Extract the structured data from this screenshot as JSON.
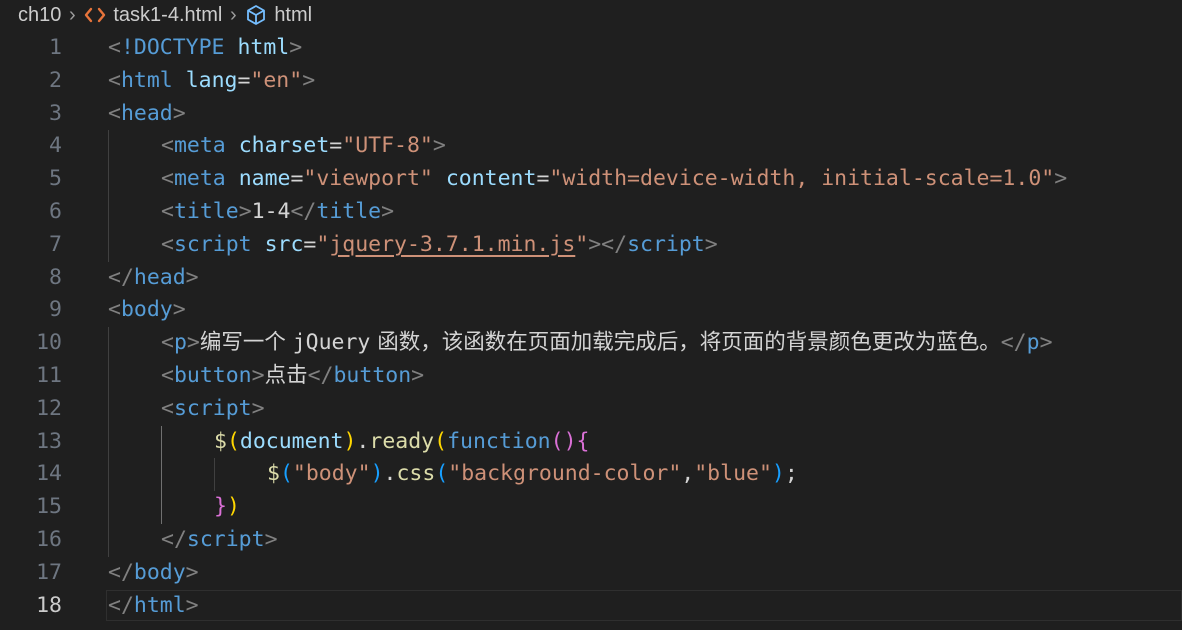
{
  "breadcrumb": {
    "folder": "ch10",
    "file": "task1-4.html",
    "symbol": "html"
  },
  "editor": {
    "current_line": "18",
    "lines": [
      {
        "n": "1",
        "indent": 0,
        "tokens": [
          [
            "punc",
            "<"
          ],
          [
            "tag",
            "!DOCTYPE"
          ],
          [
            "text",
            " "
          ],
          [
            "attr",
            "html"
          ],
          [
            "punc",
            ">"
          ]
        ]
      },
      {
        "n": "2",
        "indent": 0,
        "tokens": [
          [
            "punc",
            "<"
          ],
          [
            "tag",
            "html"
          ],
          [
            "text",
            " "
          ],
          [
            "attr",
            "lang"
          ],
          [
            "text",
            "="
          ],
          [
            "str",
            "\"en\""
          ],
          [
            "punc",
            ">"
          ]
        ]
      },
      {
        "n": "3",
        "indent": 0,
        "tokens": [
          [
            "punc",
            "<"
          ],
          [
            "tag",
            "head"
          ],
          [
            "punc",
            ">"
          ]
        ]
      },
      {
        "n": "4",
        "indent": 1,
        "tokens": [
          [
            "punc",
            "<"
          ],
          [
            "tag",
            "meta"
          ],
          [
            "text",
            " "
          ],
          [
            "attr",
            "charset"
          ],
          [
            "text",
            "="
          ],
          [
            "str",
            "\"UTF-8\""
          ],
          [
            "punc",
            ">"
          ]
        ]
      },
      {
        "n": "5",
        "indent": 1,
        "tokens": [
          [
            "punc",
            "<"
          ],
          [
            "tag",
            "meta"
          ],
          [
            "text",
            " "
          ],
          [
            "attr",
            "name"
          ],
          [
            "text",
            "="
          ],
          [
            "str",
            "\"viewport\""
          ],
          [
            "text",
            " "
          ],
          [
            "attr",
            "content"
          ],
          [
            "text",
            "="
          ],
          [
            "str",
            "\"width=device-width, initial-scale=1.0\""
          ],
          [
            "punc",
            ">"
          ]
        ]
      },
      {
        "n": "6",
        "indent": 1,
        "tokens": [
          [
            "punc",
            "<"
          ],
          [
            "tag",
            "title"
          ],
          [
            "punc",
            ">"
          ],
          [
            "text",
            "1-4"
          ],
          [
            "punc",
            "</"
          ],
          [
            "tag",
            "title"
          ],
          [
            "punc",
            ">"
          ]
        ]
      },
      {
        "n": "7",
        "indent": 1,
        "tokens": [
          [
            "punc",
            "<"
          ],
          [
            "tag",
            "script"
          ],
          [
            "text",
            " "
          ],
          [
            "attr",
            "src"
          ],
          [
            "text",
            "="
          ],
          [
            "str",
            "\""
          ],
          [
            "link",
            "jquery-3.7.1.min.js"
          ],
          [
            "str",
            "\""
          ],
          [
            "punc",
            "></"
          ],
          [
            "tag",
            "script"
          ],
          [
            "punc",
            ">"
          ]
        ]
      },
      {
        "n": "8",
        "indent": 0,
        "tokens": [
          [
            "punc",
            "</"
          ],
          [
            "tag",
            "head"
          ],
          [
            "punc",
            ">"
          ]
        ]
      },
      {
        "n": "9",
        "indent": 0,
        "tokens": [
          [
            "punc",
            "<"
          ],
          [
            "tag",
            "body"
          ],
          [
            "punc",
            ">"
          ]
        ]
      },
      {
        "n": "10",
        "indent": 1,
        "tokens": [
          [
            "punc",
            "<"
          ],
          [
            "tag",
            "p"
          ],
          [
            "punc",
            ">"
          ],
          [
            "cjk",
            "编写一个 "
          ],
          [
            "text",
            "jQuery"
          ],
          [
            "cjk",
            " 函数，该函数在页面加载完成后，将页面的背景颜色更改为蓝色。"
          ],
          [
            "punc",
            "</"
          ],
          [
            "tag",
            "p"
          ],
          [
            "punc",
            ">"
          ]
        ]
      },
      {
        "n": "11",
        "indent": 1,
        "tokens": [
          [
            "punc",
            "<"
          ],
          [
            "tag",
            "button"
          ],
          [
            "punc",
            ">"
          ],
          [
            "cjk",
            "点击"
          ],
          [
            "punc",
            "</"
          ],
          [
            "tag",
            "button"
          ],
          [
            "punc",
            ">"
          ]
        ]
      },
      {
        "n": "12",
        "indent": 1,
        "tokens": [
          [
            "punc",
            "<"
          ],
          [
            "tag",
            "script"
          ],
          [
            "punc",
            ">"
          ]
        ]
      },
      {
        "n": "13",
        "indent": 2,
        "tokens": [
          [
            "fn",
            "$"
          ],
          [
            "br1",
            "("
          ],
          [
            "var",
            "document"
          ],
          [
            "br1",
            ")"
          ],
          [
            "text",
            "."
          ],
          [
            "fn",
            "ready"
          ],
          [
            "br1",
            "("
          ],
          [
            "kw",
            "function"
          ],
          [
            "br2",
            "()"
          ],
          [
            "br2",
            "{"
          ]
        ]
      },
      {
        "n": "14",
        "indent": 3,
        "tokens": [
          [
            "fn",
            "$"
          ],
          [
            "br3",
            "("
          ],
          [
            "str",
            "\"body\""
          ],
          [
            "br3",
            ")"
          ],
          [
            "text",
            "."
          ],
          [
            "fn",
            "css"
          ],
          [
            "br3",
            "("
          ],
          [
            "str",
            "\"background-color\""
          ],
          [
            "text",
            ","
          ],
          [
            "str",
            "\"blue\""
          ],
          [
            "br3",
            ")"
          ],
          [
            "text",
            ";"
          ]
        ]
      },
      {
        "n": "15",
        "indent": 2,
        "tokens": [
          [
            "br2",
            "}"
          ],
          [
            "br1",
            ")"
          ]
        ]
      },
      {
        "n": "16",
        "indent": 1,
        "tokens": [
          [
            "punc",
            "</"
          ],
          [
            "tag",
            "script"
          ],
          [
            "punc",
            ">"
          ]
        ]
      },
      {
        "n": "17",
        "indent": 0,
        "tokens": [
          [
            "punc",
            "</"
          ],
          [
            "tag",
            "body"
          ],
          [
            "punc",
            ">"
          ]
        ]
      },
      {
        "n": "18",
        "indent": 0,
        "tokens": [
          [
            "punc",
            "</"
          ],
          [
            "tag",
            "html"
          ],
          [
            "punc",
            ">"
          ]
        ]
      }
    ]
  },
  "colors": {
    "background": "#1f1f1f",
    "tag": "#569cd6",
    "attribute": "#9cdcfe",
    "string": "#ce9178",
    "function": "#dcdcaa",
    "bracket_level1": "#ffd700",
    "bracket_level2": "#da70d6",
    "bracket_level3": "#179fff"
  },
  "icons": {
    "file_icon": "html-brackets-icon",
    "symbol_icon": "cube-icon",
    "separator_icon": "chevron-right-icon"
  }
}
